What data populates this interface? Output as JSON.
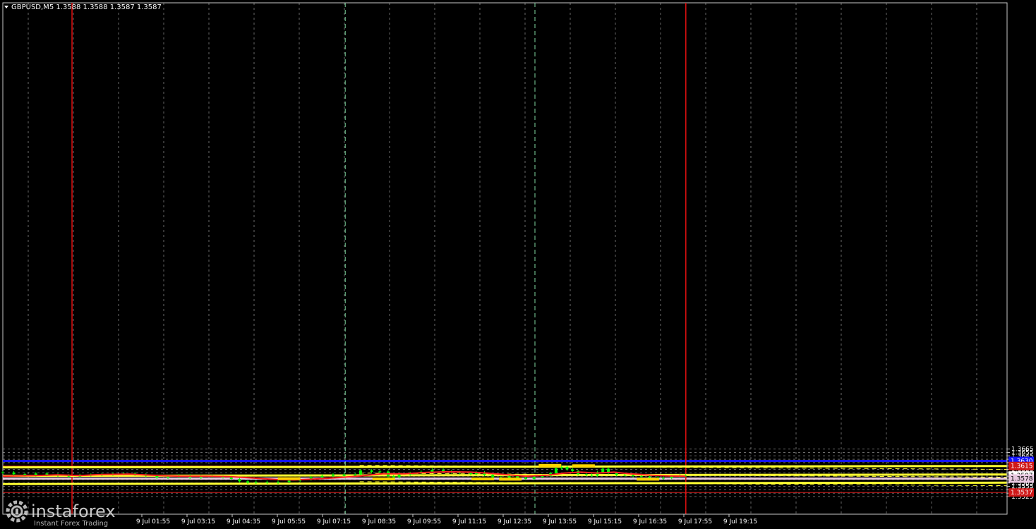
{
  "header": {
    "symbol_line": "GBPUSD,M5  1.3588 1.3588 1.3587 1.3587",
    "arrow_icon": "triangle-down-icon"
  },
  "watermark": {
    "brand": "instaforex",
    "tagline": "Instant Forex Trading",
    "icon": "gear-logo-icon"
  },
  "colors": {
    "background": "#000000",
    "grid": "#c0c0c0",
    "candle_up": "#00ff00",
    "candle_down": "#00ff00",
    "ma": "#ff2020",
    "channel": "#ffff33",
    "level_blue": "#1414ff",
    "level_red": "#d01818",
    "level_pink": "#e8c8e0",
    "signal_box": "#ffd400",
    "axis_text": "#ffffff"
  },
  "chart_data": {
    "type": "candlestick",
    "symbol": "GBPUSD",
    "timeframe": "M5",
    "ylim": [
      1.3519,
      1.3675
    ],
    "y_ticks": [
      "1.3665",
      "1.3655",
      "1.3645",
      "1.3635",
      "1.3625",
      "1.3615",
      "1.3605",
      "1.3595",
      "1.3585",
      "1.3575",
      "1.3565",
      "1.3555",
      "1.3545",
      "1.3535",
      "1.3525"
    ],
    "x_ticks": [
      "9 Jul 01:55",
      "9 Jul 03:15",
      "9 Jul 04:35",
      "9 Jul 05:55",
      "9 Jul 07:15",
      "9 Jul 08:35",
      "9 Jul 09:55",
      "9 Jul 11:15",
      "9 Jul 12:35",
      "9 Jul 13:55",
      "9 Jul 15:15",
      "9 Jul 16:35",
      "9 Jul 17:55",
      "9 Jul 19:15"
    ],
    "price_badges": [
      {
        "label": "1.3630",
        "price": 1.363,
        "bg": "#1414ff",
        "fg": "#ffffff"
      },
      {
        "label": "1.3615",
        "price": 1.3615,
        "bg": "#d01818",
        "fg": "#ffffff"
      },
      {
        "label": "1.3587",
        "price": 1.3587,
        "bg": "#ffffff",
        "fg": "#000000"
      },
      {
        "label": "1.3578",
        "price": 1.3578,
        "bg": "#e8c8e0",
        "fg": "#000000"
      },
      {
        "label": "1.3537",
        "price": 1.3537,
        "bg": "#d01818",
        "fg": "#ffffff"
      }
    ],
    "horizontal_levels": [
      {
        "name": "resistance",
        "price": 1.363,
        "color": "#1414ff"
      },
      {
        "name": "resistance",
        "price": 1.3615,
        "color": "#d01818"
      },
      {
        "name": "support",
        "price": 1.3578,
        "color": "#e8c8e0"
      },
      {
        "name": "support",
        "price": 1.3537,
        "color": "#d01818"
      }
    ],
    "vertical_day_lines_x": [
      0.36,
      13.95
    ],
    "session_lines_x": [
      5.55,
      9.75
    ],
    "channel_lines": [
      {
        "from": [
          0.0,
          1.3611
        ],
        "to": [
          16.6,
          1.3615
        ],
        "style": "solid"
      },
      {
        "from": [
          0.0,
          1.3586
        ],
        "to": [
          16.6,
          1.359
        ],
        "style": "solid"
      },
      {
        "from": [
          0.0,
          1.3562
        ],
        "to": [
          16.6,
          1.3566
        ],
        "style": "solid"
      },
      {
        "from": [
          7.9,
          1.3617
        ],
        "to": [
          16.6,
          1.3605
        ],
        "style": "dashed"
      },
      {
        "from": [
          7.9,
          1.3594
        ],
        "to": [
          16.6,
          1.3582
        ],
        "style": "dashed"
      },
      {
        "from": [
          7.9,
          1.3569
        ],
        "to": [
          16.6,
          1.3557
        ],
        "style": "dashed"
      }
    ],
    "signal_boxes": [
      {
        "x": 5.2,
        "price_top": 1.3582,
        "price_bottom": 1.3574
      },
      {
        "x": 6.92,
        "price_top": 1.3581,
        "price_bottom": 1.3573
      },
      {
        "x": 8.72,
        "price_top": 1.3581,
        "price_bottom": 1.3573
      },
      {
        "x": 9.22,
        "price_top": 1.3581,
        "price_bottom": 1.3572
      },
      {
        "x": 9.94,
        "price_top": 1.3621,
        "price_bottom": 1.3611
      },
      {
        "x": 10.55,
        "price_top": 1.362,
        "price_bottom": 1.3611
      },
      {
        "x": 11.72,
        "price_top": 1.358,
        "price_bottom": 1.3572
      }
    ],
    "ma_path": [
      [
        0.0,
        1.3585
      ],
      [
        0.6,
        1.3587
      ],
      [
        1.0,
        1.3589
      ],
      [
        1.4,
        1.3587
      ],
      [
        1.8,
        1.359
      ],
      [
        2.3,
        1.3591
      ],
      [
        2.7,
        1.3588
      ],
      [
        3.2,
        1.3585
      ],
      [
        3.7,
        1.3585
      ],
      [
        4.1,
        1.3584
      ],
      [
        4.5,
        1.358
      ],
      [
        5.0,
        1.3575
      ],
      [
        5.3,
        1.3574
      ],
      [
        5.7,
        1.3577
      ],
      [
        6.1,
        1.3581
      ],
      [
        6.5,
        1.3586
      ],
      [
        6.9,
        1.3592
      ],
      [
        7.3,
        1.3592
      ],
      [
        7.7,
        1.3596
      ],
      [
        8.1,
        1.3598
      ],
      [
        8.5,
        1.3597
      ],
      [
        8.8,
        1.3594
      ],
      [
        9.1,
        1.359
      ],
      [
        9.5,
        1.3585
      ],
      [
        9.9,
        1.3588
      ],
      [
        10.2,
        1.3594
      ],
      [
        10.5,
        1.3597
      ],
      [
        10.8,
        1.3594
      ],
      [
        11.1,
        1.3597
      ],
      [
        11.4,
        1.3592
      ],
      [
        11.8,
        1.3588
      ],
      [
        12.1,
        1.3586
      ],
      [
        12.4,
        1.3585
      ]
    ],
    "candles": [
      [
        0.0,
        1.3596
      ],
      [
        0.2,
        1.3591
      ],
      [
        0.4,
        1.3588
      ],
      [
        0.6,
        1.3593
      ],
      [
        0.8,
        1.3589
      ],
      [
        1.0,
        1.3587
      ],
      [
        1.2,
        1.3584
      ],
      [
        1.4,
        1.3588
      ],
      [
        1.6,
        1.3589
      ],
      [
        1.8,
        1.359
      ],
      [
        2.0,
        1.3592
      ],
      [
        2.2,
        1.3593
      ],
      [
        2.4,
        1.359
      ],
      [
        2.6,
        1.3586
      ],
      [
        2.8,
        1.3581
      ],
      [
        3.0,
        1.3583
      ],
      [
        3.2,
        1.3587
      ],
      [
        3.4,
        1.3581
      ],
      [
        3.6,
        1.3585
      ],
      [
        3.8,
        1.3583
      ],
      [
        4.0,
        1.3582
      ],
      [
        4.15,
        1.3577
      ],
      [
        4.3,
        1.357
      ],
      [
        4.45,
        1.3566
      ],
      [
        4.6,
        1.3568
      ],
      [
        4.8,
        1.3566
      ],
      [
        5.0,
        1.3568
      ],
      [
        5.2,
        1.3572
      ],
      [
        5.4,
        1.3576
      ],
      [
        5.6,
        1.3582
      ],
      [
        5.8,
        1.3586
      ],
      [
        6.0,
        1.359
      ],
      [
        6.2,
        1.3586
      ],
      [
        6.4,
        1.359
      ],
      [
        6.5,
        1.3602
      ],
      [
        6.7,
        1.3598
      ],
      [
        6.85,
        1.3599
      ],
      [
        7.0,
        1.3585
      ],
      [
        7.1,
        1.3582
      ],
      [
        7.2,
        1.359
      ],
      [
        7.4,
        1.3594
      ],
      [
        7.6,
        1.3598
      ],
      [
        7.8,
        1.3604
      ],
      [
        8.0,
        1.3599
      ],
      [
        8.15,
        1.3596
      ],
      [
        8.3,
        1.3594
      ],
      [
        8.5,
        1.3591
      ],
      [
        8.6,
        1.3596
      ],
      [
        8.75,
        1.3589
      ],
      [
        8.9,
        1.3582
      ],
      [
        9.05,
        1.358
      ],
      [
        9.2,
        1.3585
      ],
      [
        9.35,
        1.3581
      ],
      [
        9.5,
        1.3577
      ],
      [
        9.65,
        1.3583
      ],
      [
        9.8,
        1.3586
      ],
      [
        9.95,
        1.3594
      ],
      [
        10.05,
        1.3608
      ],
      [
        10.15,
        1.3612
      ],
      [
        10.25,
        1.3605
      ],
      [
        10.35,
        1.36
      ],
      [
        10.45,
        1.3591
      ],
      [
        10.6,
        1.3589
      ],
      [
        10.7,
        1.3587
      ],
      [
        10.8,
        1.3597
      ],
      [
        10.9,
        1.3607
      ],
      [
        11.0,
        1.3594
      ],
      [
        11.15,
        1.3589
      ],
      [
        11.3,
        1.3588
      ],
      [
        11.45,
        1.3585
      ],
      [
        11.6,
        1.3584
      ],
      [
        11.75,
        1.3581
      ],
      [
        11.9,
        1.3579
      ],
      [
        12.0,
        1.358
      ],
      [
        12.15,
        1.3584
      ],
      [
        12.3,
        1.3587
      ],
      [
        12.4,
        1.3587
      ]
    ]
  }
}
